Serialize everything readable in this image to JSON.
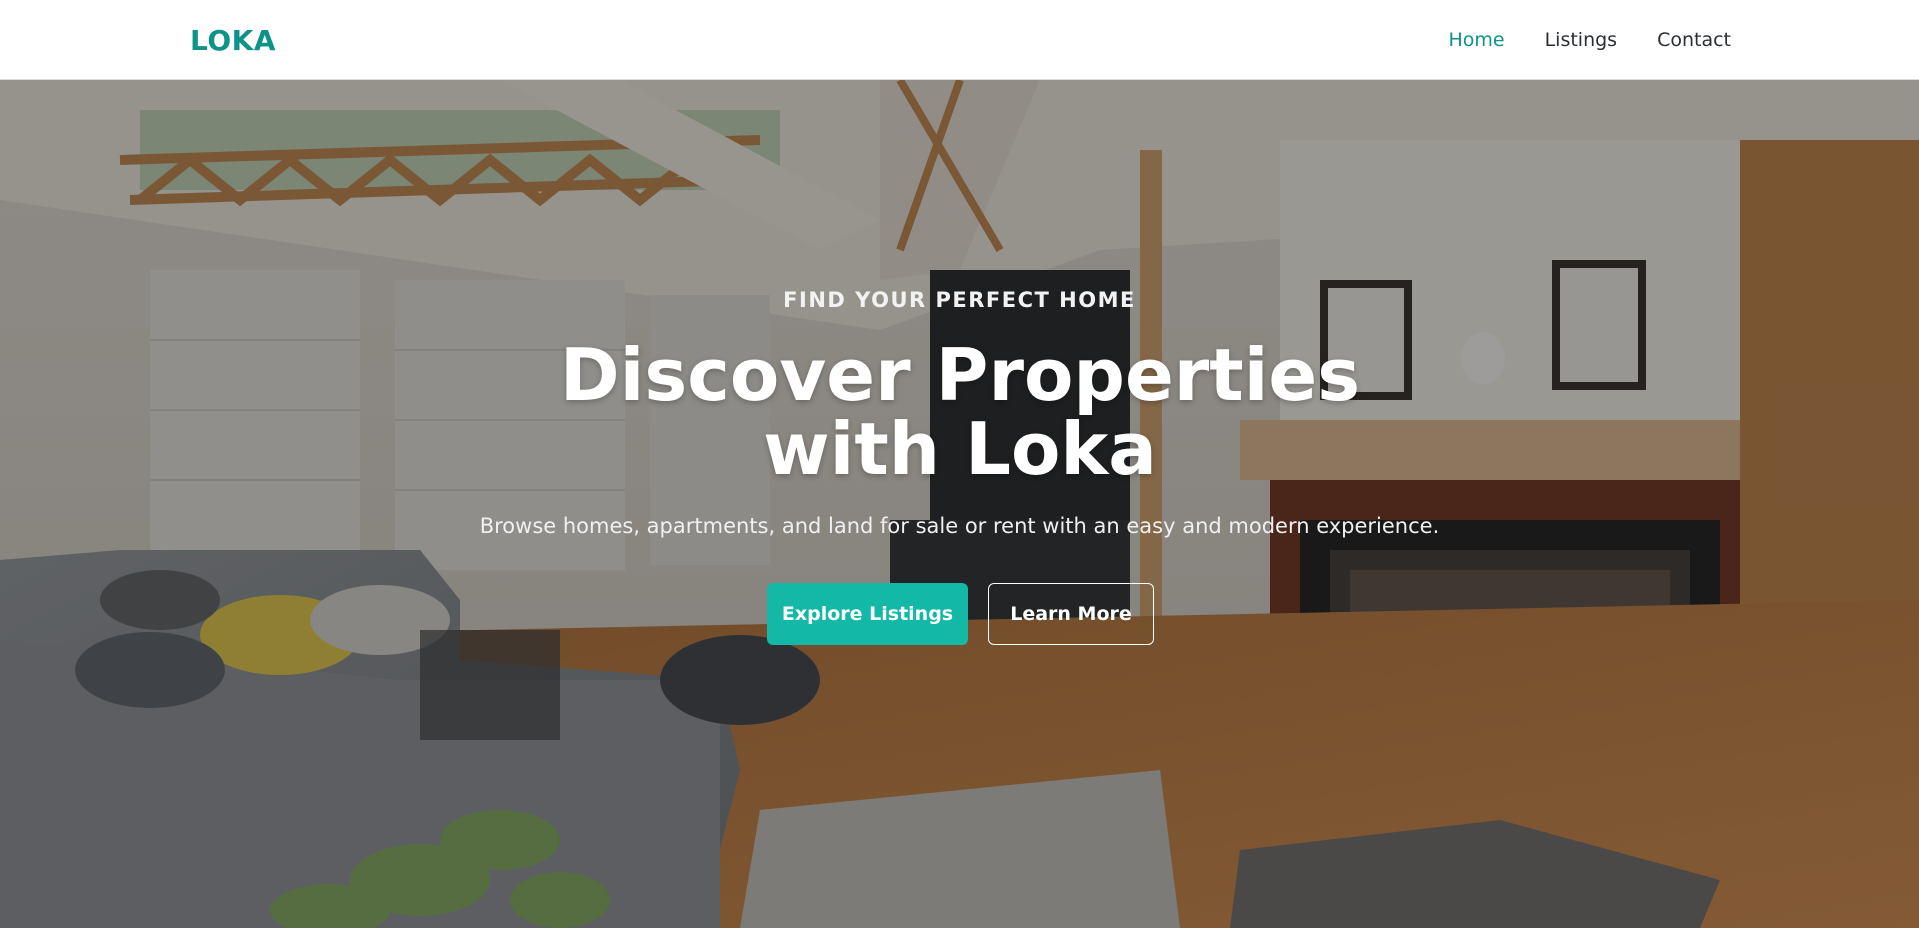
{
  "brand": {
    "logo_text": "LOKA",
    "accent_color": "#0d9488",
    "button_color": "#14b8a6"
  },
  "nav": {
    "items": [
      {
        "label": "Home",
        "active": true
      },
      {
        "label": "Listings",
        "active": false
      },
      {
        "label": "Contact",
        "active": false
      }
    ]
  },
  "hero": {
    "eyebrow": "FIND YOUR PERFECT HOME",
    "headline_line1": "Discover Properties",
    "headline_line2": "with Loka",
    "subtext": "Browse homes, apartments, and land for sale or rent with an easy and modern experience.",
    "primary_button": "Explore Listings",
    "secondary_button": "Learn More",
    "background_image": "living-room-with-fireplace-photo"
  }
}
